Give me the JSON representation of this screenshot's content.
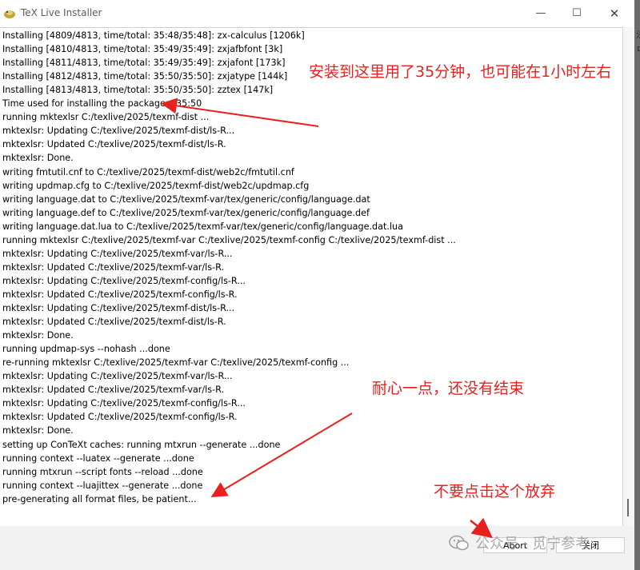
{
  "window": {
    "title": "TeX Live Installer",
    "controls": [
      "minimize-icon",
      "maximize-icon",
      "close-icon"
    ],
    "minimize_glyph": "—",
    "maximize_glyph": "☐",
    "close_glyph": "✕"
  },
  "log": {
    "lines": [
      "Installing [4809/4813, time/total: 35:48/35:48]: zx-calculus [1206k]",
      "Installing [4810/4813, time/total: 35:49/35:49]: zxjafbfont [3k]",
      "Installing [4811/4813, time/total: 35:49/35:49]: zxjafont [173k]",
      "Installing [4812/4813, time/total: 35:50/35:50]: zxjatype [144k]",
      "Installing [4813/4813, time/total: 35:50/35:50]: zztex [147k]",
      "Time used for installing the packages: 35:50",
      "running mktexlsr C:/texlive/2025/texmf-dist ...",
      "mktexlsr: Updating C:/texlive/2025/texmf-dist/ls-R...",
      "mktexlsr: Updated C:/texlive/2025/texmf-dist/ls-R.",
      "mktexlsr: Done.",
      "writing fmtutil.cnf to C:/texlive/2025/texmf-dist/web2c/fmtutil.cnf",
      "writing updmap.cfg to C:/texlive/2025/texmf-dist/web2c/updmap.cfg",
      "writing language.dat to C:/texlive/2025/texmf-var/tex/generic/config/language.dat",
      "writing language.def to C:/texlive/2025/texmf-var/tex/generic/config/language.def",
      "writing language.dat.lua to C:/texlive/2025/texmf-var/tex/generic/config/language.dat.lua",
      "running mktexlsr C:/texlive/2025/texmf-var C:/texlive/2025/texmf-config C:/texlive/2025/texmf-dist ...",
      "mktexlsr: Updating C:/texlive/2025/texmf-var/ls-R...",
      "mktexlsr: Updated C:/texlive/2025/texmf-var/ls-R.",
      "mktexlsr: Updating C:/texlive/2025/texmf-config/ls-R...",
      "mktexlsr: Updated C:/texlive/2025/texmf-config/ls-R.",
      "mktexlsr: Updating C:/texlive/2025/texmf-dist/ls-R...",
      "mktexlsr: Updated C:/texlive/2025/texmf-dist/ls-R.",
      "mktexlsr: Done.",
      "running updmap-sys --nohash ...done",
      "re-running mktexlsr C:/texlive/2025/texmf-var C:/texlive/2025/texmf-config ...",
      "mktexlsr: Updating C:/texlive/2025/texmf-var/ls-R...",
      "mktexlsr: Updated C:/texlive/2025/texmf-var/ls-R.",
      "mktexlsr: Updating C:/texlive/2025/texmf-config/ls-R...",
      "mktexlsr: Updated C:/texlive/2025/texmf-config/ls-R.",
      "mktexlsr: Done.",
      "setting up ConTeXt caches: running mtxrun --generate ...done",
      "running context --luatex --generate ...done",
      "running mtxrun --script fonts --reload ...done",
      "running context --luajittex --generate ...done",
      "pre-generating all format files, be patient..."
    ]
  },
  "buttons": {
    "abort": "Abort",
    "close": "关闭"
  },
  "annotations": {
    "note_time": "安装到这里用了35分钟，也可能在1小时左右",
    "note_patience": "耐心一点，还没有结束",
    "note_abort": "不要点击这个放弃",
    "color": "#e8201e"
  },
  "watermark": {
    "text": "公众号 · 觅宁参考"
  },
  "side_glyphs": [
    "法",
    "ㅁ"
  ]
}
